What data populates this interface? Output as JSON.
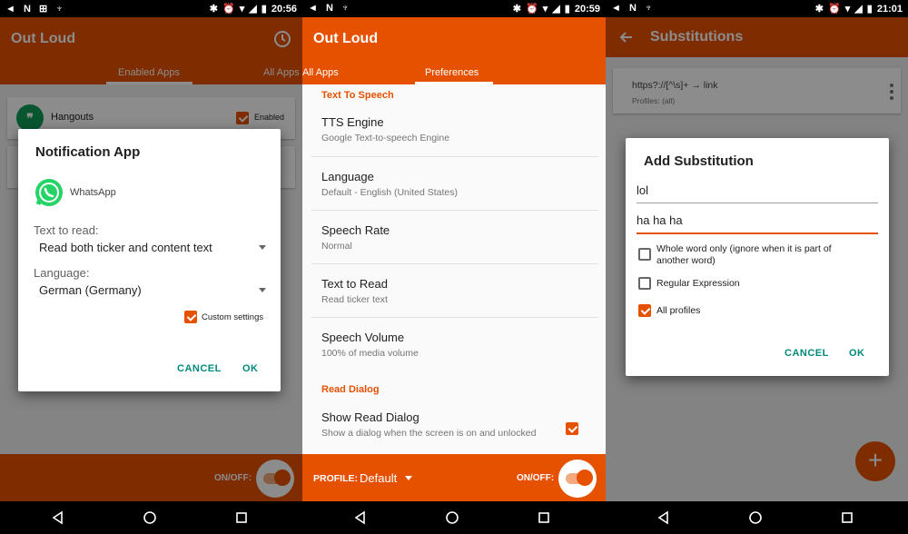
{
  "statusbar": [
    {
      "icons": "◄ N ⊞ ♆",
      "right": "✱ ⏰ ▾ ◢ ▮",
      "time": "20:56"
    },
    {
      "icons": "◄ N ♆",
      "right": "✱ ⏰ ▾ ◢ ▮",
      "time": "20:59"
    },
    {
      "icons": "◄ N ♆",
      "right": "✱ ⏰ ▾ ◢ ▮",
      "time": "21:01"
    }
  ],
  "screen1": {
    "app_title": "Out Loud",
    "tabs": [
      "Enabled Apps",
      "All Apps"
    ],
    "list": [
      {
        "name": "Hangouts",
        "checkbox_label": "Enabled"
      }
    ],
    "onoff_label": "ON/OFF:",
    "dialog": {
      "title": "Notification App",
      "app_name": "WhatsApp",
      "text_label": "Text to read:",
      "text_value": "Read both ticker and content text",
      "language_label": "Language:",
      "language_value": "German (Germany)",
      "custom_label": "Custom settings",
      "cancel": "CANCEL",
      "ok": "OK"
    }
  },
  "screen2": {
    "app_title": "Out Loud",
    "tabs": [
      "All Apps",
      "Preferences"
    ],
    "sections": [
      {
        "header": "Text To Speech"
      },
      {
        "header": "Read Dialog"
      }
    ],
    "prefs": [
      {
        "title": "TTS Engine",
        "summary": "Google Text-to-speech Engine"
      },
      {
        "title": "Language",
        "summary": "Default - English (United States)"
      },
      {
        "title": "Speech Rate",
        "summary": "Normal"
      },
      {
        "title": "Text to Read",
        "summary": "Read ticker text"
      },
      {
        "title": "Speech Volume",
        "summary": "100% of media volume"
      },
      {
        "title": "Show Read Dialog",
        "summary": "Show a dialog when the screen is on and unlocked"
      }
    ],
    "profile_label": "PROFILE:",
    "profile_value": "Default",
    "onoff_label": "ON/OFF:"
  },
  "screen3": {
    "title": "Substitutions",
    "item": {
      "rule": "https?://[^\\s]+ → link",
      "profiles": "Profiles: (all)"
    },
    "dialog": {
      "title": "Add Substitution",
      "find_value": "lol",
      "replace_value": "ha ha ha",
      "options": [
        {
          "label": "Whole word only (ignore when it is part of another word)",
          "checked": false
        },
        {
          "label": "Regular Expression",
          "checked": false
        },
        {
          "label": "All profiles",
          "checked": true
        }
      ],
      "cancel": "CANCEL",
      "ok": "OK"
    },
    "fab_symbol": "+"
  },
  "colors": {
    "primary": "#e65100",
    "accent_button": "#00897b"
  }
}
